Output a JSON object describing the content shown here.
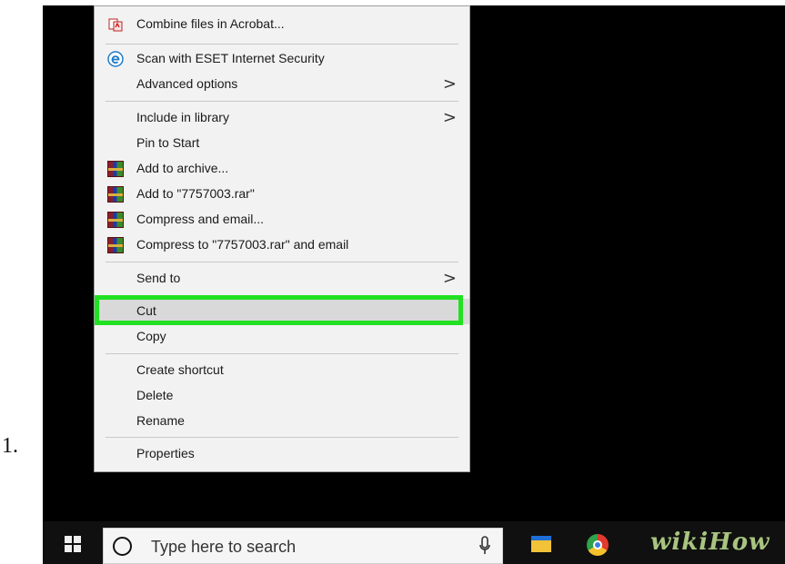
{
  "step_number": "1.",
  "menu": {
    "items": [
      {
        "label": "Combine files in Acrobat...",
        "icon": "acrobat-icon",
        "submenu": false
      },
      {
        "label": "Scan with ESET Internet Security",
        "icon": "eset-icon",
        "submenu": false
      },
      {
        "label": "Advanced options",
        "icon": "",
        "submenu": true
      },
      {
        "label": "Include in library",
        "icon": "",
        "submenu": true
      },
      {
        "label": "Pin to Start",
        "icon": "",
        "submenu": false
      },
      {
        "label": "Add to archive...",
        "icon": "winrar-icon",
        "submenu": false
      },
      {
        "label": "Add to \"7757003.rar\"",
        "icon": "winrar-icon",
        "submenu": false
      },
      {
        "label": "Compress and email...",
        "icon": "winrar-icon",
        "submenu": false
      },
      {
        "label": "Compress to \"7757003.rar\" and email",
        "icon": "winrar-icon",
        "submenu": false
      },
      {
        "label": "Send to",
        "icon": "",
        "submenu": true
      },
      {
        "label": "Cut",
        "icon": "",
        "submenu": false,
        "highlighted": true
      },
      {
        "label": "Copy",
        "icon": "",
        "submenu": false
      },
      {
        "label": "Create shortcut",
        "icon": "",
        "submenu": false
      },
      {
        "label": "Delete",
        "icon": "",
        "submenu": false
      },
      {
        "label": "Rename",
        "icon": "",
        "submenu": false
      },
      {
        "label": "Properties",
        "icon": "",
        "submenu": false
      }
    ],
    "chevron": ">"
  },
  "taskbar": {
    "search_placeholder": "Type here to search"
  },
  "watermark": "wikiHow",
  "colors": {
    "highlight_border": "#22e022",
    "menu_background": "#f2f2f2",
    "screen_background": "#000000"
  }
}
